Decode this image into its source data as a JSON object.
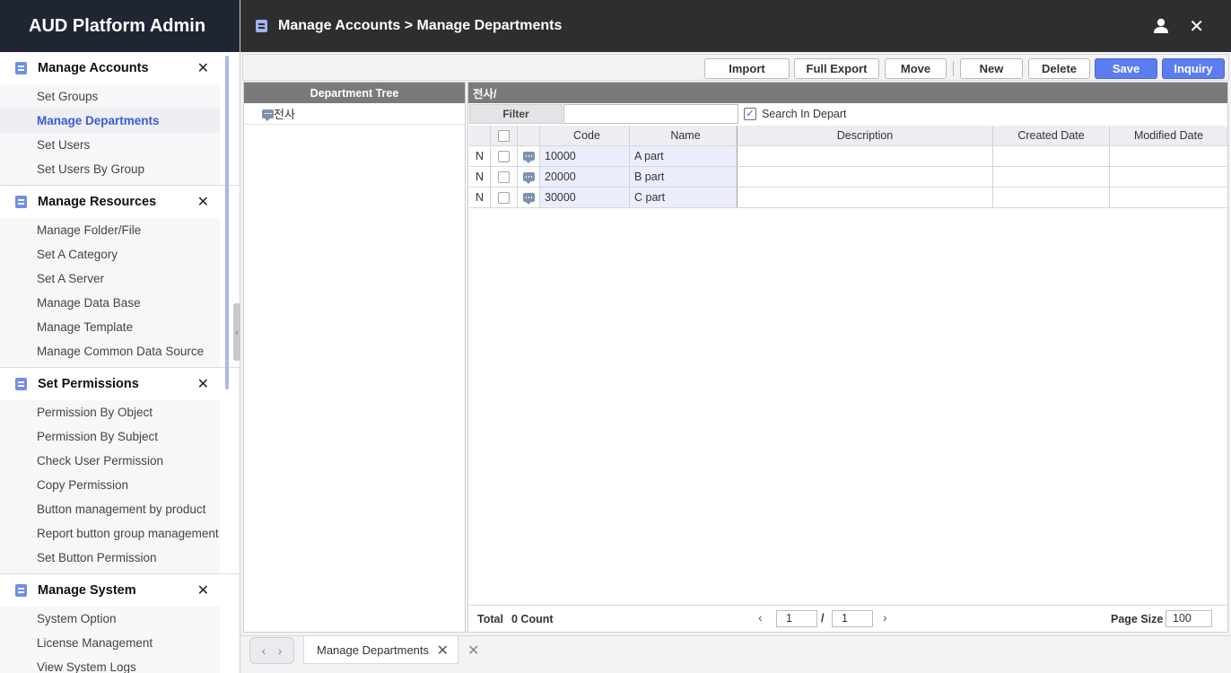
{
  "app": {
    "title": "AUD Platform Admin"
  },
  "topbar": {
    "breadcrumb": "Manage Accounts > Manage Departments",
    "user_icon": "user-icon",
    "close_icon": "close-icon"
  },
  "sidebar": {
    "sections": [
      {
        "title": "Manage Accounts",
        "items": [
          "Set Groups",
          "Manage Departments",
          "Set Users",
          "Set Users By Group"
        ],
        "active": "Manage Departments"
      },
      {
        "title": "Manage Resources",
        "items": [
          "Manage Folder/File",
          "Set A Category",
          "Set A Server",
          "Manage Data Base",
          "Manage Template",
          "Manage Common Data Source"
        ]
      },
      {
        "title": "Set Permissions",
        "items": [
          "Permission By Object",
          "Permission By Subject",
          "Check User Permission",
          "Copy Permission",
          "Button management by product",
          "Report button group management",
          "Set Button Permission"
        ]
      },
      {
        "title": "Manage System",
        "items": [
          "System Option",
          "License Management",
          "View System Logs"
        ]
      }
    ]
  },
  "toolbar": {
    "import": "Import",
    "full_export": "Full Export",
    "move": "Move",
    "new": "New",
    "delete": "Delete",
    "save": "Save",
    "inquiry": "Inquiry"
  },
  "tree": {
    "header": "Department Tree",
    "root": "전사"
  },
  "grid": {
    "title": "전사/",
    "filter_label": "Filter",
    "filter_value": "",
    "search_in_dept_label": "Search In Departı",
    "search_in_dept_checked": true,
    "columns": [
      "",
      "",
      "",
      "Code",
      "Name",
      "Description",
      "Created Date",
      "Modified Date"
    ],
    "rows": [
      {
        "status": "N",
        "code": "10000",
        "name": "A part",
        "description": "",
        "created": "",
        "modified": ""
      },
      {
        "status": "N",
        "code": "20000",
        "name": "B part",
        "description": "",
        "created": "",
        "modified": ""
      },
      {
        "status": "N",
        "code": "30000",
        "name": "C part",
        "description": "",
        "created": "",
        "modified": ""
      }
    ],
    "footer": {
      "total_label": "Total",
      "total_count": "0 Count",
      "page_current": "1",
      "page_slash": "/",
      "page_total": "1",
      "page_size_label": "Page Size",
      "page_size": "100"
    }
  },
  "tabs": {
    "active": "Manage Departments"
  },
  "colors": {
    "primary": "#5b7df0",
    "sidebar_header": "#1f2533",
    "topbar": "#2e2e2e",
    "grid_header": "#7a7a7a",
    "active_link": "#3a5bd8"
  }
}
